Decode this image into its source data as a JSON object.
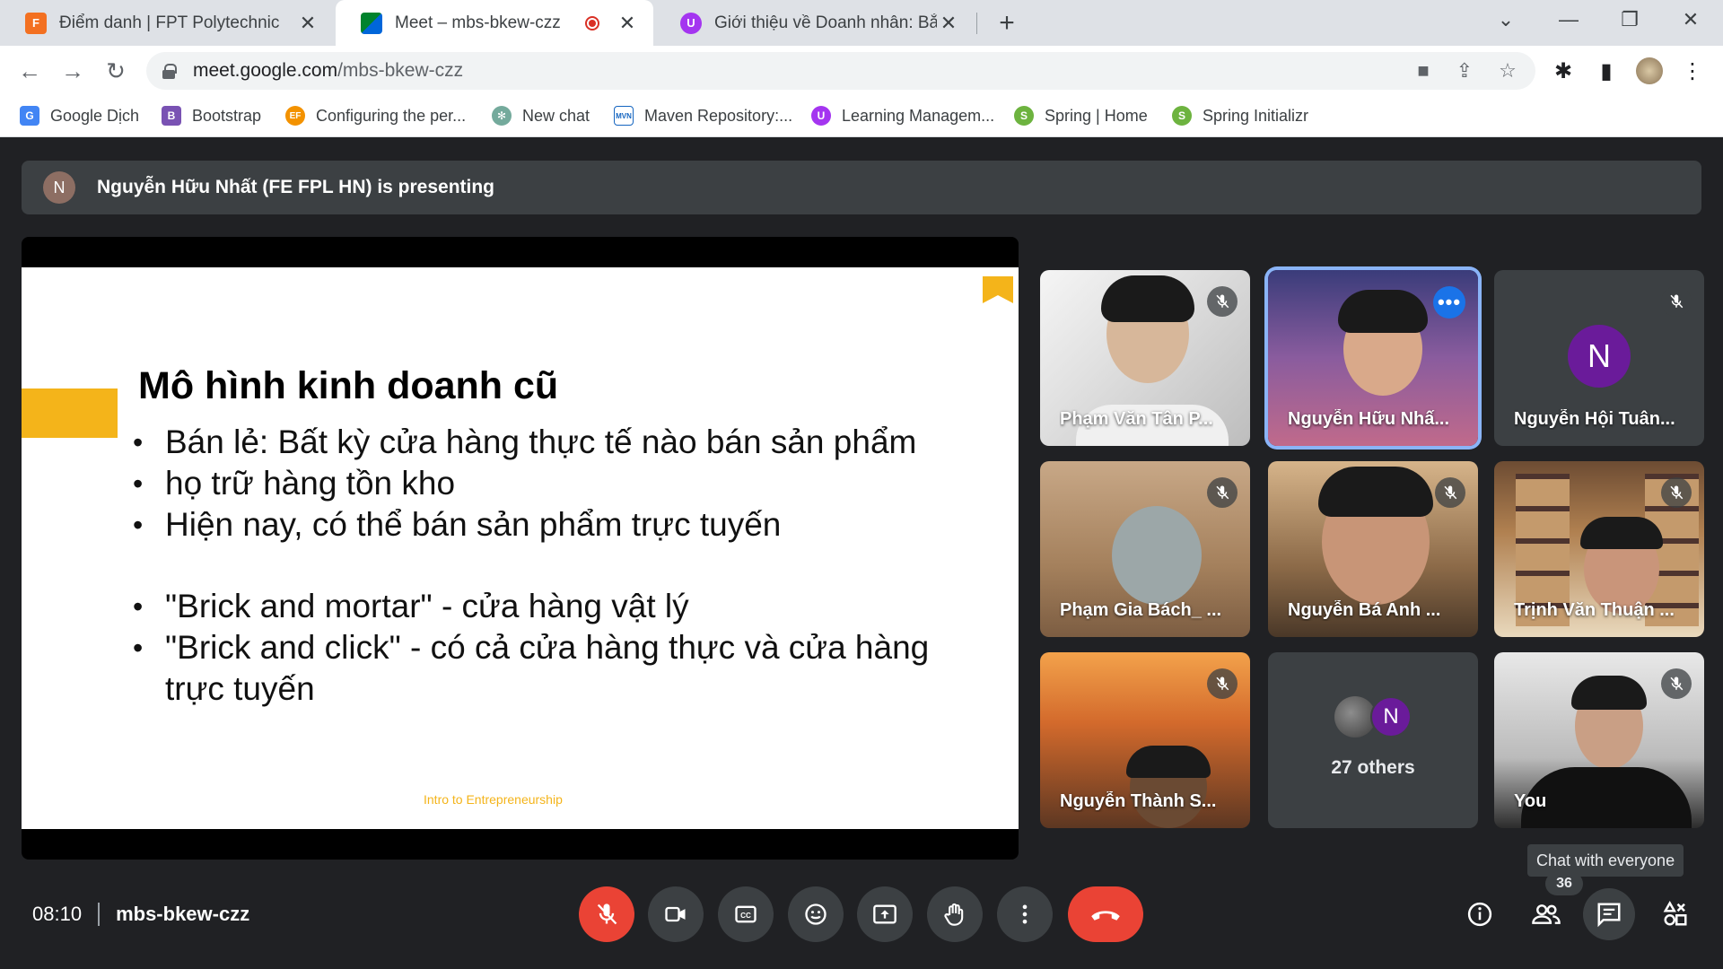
{
  "browser": {
    "tabs": [
      {
        "title": "Điểm danh | FPT Polytechnic",
        "favicon": "fpt-icon"
      },
      {
        "title": "Meet – mbs-bkew-czz",
        "favicon": "meet-icon",
        "active": true
      },
      {
        "title": "Giới thiệu về Doanh nhân: Bắt đầ",
        "favicon": "course-icon"
      }
    ],
    "url_host": "meet.google.com",
    "url_path": "/mbs-bkew-czz",
    "bookmarks": [
      {
        "label": "Google Dịch",
        "icon": "G"
      },
      {
        "label": "Bootstrap",
        "icon": "B"
      },
      {
        "label": "Configuring the per...",
        "icon": "EF"
      },
      {
        "label": "New chat",
        "icon": "✻"
      },
      {
        "label": "Maven Repository:...",
        "icon": "MVN"
      },
      {
        "label": "Learning Managem...",
        "icon": "U"
      },
      {
        "label": "Spring | Home",
        "icon": "S"
      },
      {
        "label": "Spring Initializr",
        "icon": "S"
      }
    ]
  },
  "meet": {
    "presenter_initial": "N",
    "presenting_text": "Nguyễn Hữu Nhất (FE FPL HN) is presenting",
    "slide": {
      "title": "Mô hình kinh doanh cũ",
      "bullets_1": [
        "Bán lẻ: Bất kỳ cửa hàng thực tế nào bán sản phẩm",
        "họ trữ hàng tồn kho",
        "Hiện nay, có thể bán sản phẩm trực tuyến"
      ],
      "bullets_2": [
        "\"Brick and mortar\" - cửa hàng vật lý",
        "\"Brick and click\" - có cả cửa hàng thực và cửa hàng trực tuyến"
      ],
      "footer": "Intro to Entrepreneurship"
    },
    "participants": [
      {
        "name": "Phạm Văn Tân P..."
      },
      {
        "name": "Nguyễn Hữu Nhấ..."
      },
      {
        "name": "Nguyễn Hội Tuân...",
        "initial": "N"
      },
      {
        "name": "Phạm Gia Bách_ ..."
      },
      {
        "name": "Nguyễn Bá Anh ..."
      },
      {
        "name": "Trịnh Văn Thuận ..."
      },
      {
        "name": "Nguyễn Thành S..."
      },
      {
        "name": "You"
      }
    ],
    "others_initial": "N",
    "others_label": "27 others",
    "tooltip": "Chat with everyone",
    "participant_count": "36",
    "time": "08:10",
    "meeting_code": "mbs-bkew-czz"
  }
}
